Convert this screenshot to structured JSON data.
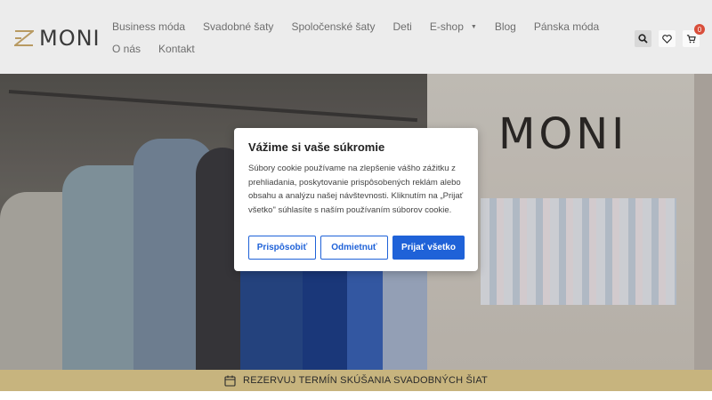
{
  "brand": {
    "name": "MONI"
  },
  "nav": {
    "row1": [
      "Business móda",
      "Svadobné šaty",
      "Spoločenské šaty",
      "Deti",
      "E-shop",
      "Blog",
      "Pánska móda"
    ],
    "row2": [
      "O nás",
      "Kontakt"
    ]
  },
  "header_icons": [
    {
      "name": "search-icon"
    },
    {
      "name": "heart-icon"
    },
    {
      "name": "cart-icon",
      "badge": "0"
    }
  ],
  "hero": {
    "store_sign": "MONI"
  },
  "cookie": {
    "title": "Vážime si vaše súkromie",
    "body": "Súbory cookie používame na zlepšenie vášho zážitku z prehliadania, poskytovanie prispôsobených reklám alebo obsahu a analýzu našej návštevnosti. Kliknutím na „Prijať všetko\" súhlasíte s naším používaním súborov cookie.",
    "customize": "Prispôsobiť",
    "reject": "Odmietnuť",
    "accept": "Prijať všetko"
  },
  "booking": {
    "label": "REZERVUJ TERMÍN SKÚŠANIA SVADOBNÝCH ŠIAT"
  },
  "colors": {
    "accent": "#1f62d8",
    "gold": "#c7b47e",
    "badge": "#d94e3a"
  }
}
